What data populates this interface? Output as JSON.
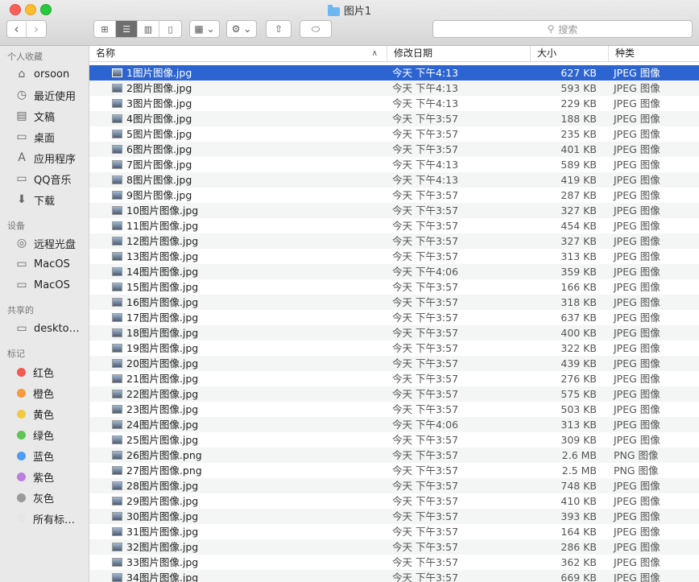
{
  "window": {
    "title": "图片1"
  },
  "toolbar": {
    "back_icon": "‹",
    "forward_icon": "›",
    "view_icons": [
      "⊞",
      "☰",
      "▥",
      "▯"
    ],
    "group_icon": "▦ ⌄",
    "action_icon": "⚙ ⌄",
    "share_icon": "⇧",
    "tag_icon": "⬭",
    "search_placeholder": "搜索"
  },
  "sidebar": {
    "favorites_title": "个人收藏",
    "favorites": [
      {
        "label": "orsoon",
        "icon": "⌂"
      },
      {
        "label": "最近使用",
        "icon": "◷"
      },
      {
        "label": "文稿",
        "icon": "▤"
      },
      {
        "label": "桌面",
        "icon": "▭"
      },
      {
        "label": "应用程序",
        "icon": "A"
      },
      {
        "label": "QQ音乐",
        "icon": "▭"
      },
      {
        "label": "下载",
        "icon": "⬇"
      }
    ],
    "devices_title": "设备",
    "devices": [
      {
        "label": "远程光盘",
        "icon": "◎"
      },
      {
        "label": "MacOS",
        "icon": "▭"
      },
      {
        "label": "MacOS",
        "icon": "▭"
      }
    ],
    "shared_title": "共享的",
    "shared": [
      {
        "label": "deskto…",
        "icon": "▭"
      }
    ],
    "tags_title": "标记",
    "tags": [
      {
        "label": "红色",
        "color": "#f05a4f"
      },
      {
        "label": "橙色",
        "color": "#f59a3b"
      },
      {
        "label": "黄色",
        "color": "#f3c941"
      },
      {
        "label": "绿色",
        "color": "#5cc755"
      },
      {
        "label": "蓝色",
        "color": "#4f9cf3"
      },
      {
        "label": "紫色",
        "color": "#bb7fdc"
      },
      {
        "label": "灰色",
        "color": "#9a9a9a"
      },
      {
        "label": "所有标…",
        "color": "#e6e6e6"
      }
    ]
  },
  "columns": {
    "name": "名称",
    "sort_icon": "∧",
    "date": "修改日期",
    "size": "大小",
    "kind": "种类"
  },
  "files": [
    {
      "name": "1图片图像.jpg",
      "date": "今天 下午4:13",
      "size": "627 KB",
      "kind": "JPEG 图像"
    },
    {
      "name": "2图片图像.jpg",
      "date": "今天 下午4:13",
      "size": "593 KB",
      "kind": "JPEG 图像"
    },
    {
      "name": "3图片图像.jpg",
      "date": "今天 下午4:13",
      "size": "229 KB",
      "kind": "JPEG 图像"
    },
    {
      "name": "4图片图像.jpg",
      "date": "今天 下午3:57",
      "size": "188 KB",
      "kind": "JPEG 图像"
    },
    {
      "name": "5图片图像.jpg",
      "date": "今天 下午3:57",
      "size": "235 KB",
      "kind": "JPEG 图像"
    },
    {
      "name": "6图片图像.jpg",
      "date": "今天 下午3:57",
      "size": "401 KB",
      "kind": "JPEG 图像"
    },
    {
      "name": "7图片图像.jpg",
      "date": "今天 下午4:13",
      "size": "589 KB",
      "kind": "JPEG 图像"
    },
    {
      "name": "8图片图像.jpg",
      "date": "今天 下午4:13",
      "size": "419 KB",
      "kind": "JPEG 图像"
    },
    {
      "name": "9图片图像.jpg",
      "date": "今天 下午3:57",
      "size": "287 KB",
      "kind": "JPEG 图像"
    },
    {
      "name": "10图片图像.jpg",
      "date": "今天 下午3:57",
      "size": "327 KB",
      "kind": "JPEG 图像"
    },
    {
      "name": "11图片图像.jpg",
      "date": "今天 下午3:57",
      "size": "454 KB",
      "kind": "JPEG 图像"
    },
    {
      "name": "12图片图像.jpg",
      "date": "今天 下午3:57",
      "size": "327 KB",
      "kind": "JPEG 图像"
    },
    {
      "name": "13图片图像.jpg",
      "date": "今天 下午3:57",
      "size": "313 KB",
      "kind": "JPEG 图像"
    },
    {
      "name": "14图片图像.jpg",
      "date": "今天 下午4:06",
      "size": "359 KB",
      "kind": "JPEG 图像"
    },
    {
      "name": "15图片图像.jpg",
      "date": "今天 下午3:57",
      "size": "166 KB",
      "kind": "JPEG 图像"
    },
    {
      "name": "16图片图像.jpg",
      "date": "今天 下午3:57",
      "size": "318 KB",
      "kind": "JPEG 图像"
    },
    {
      "name": "17图片图像.jpg",
      "date": "今天 下午3:57",
      "size": "637 KB",
      "kind": "JPEG 图像"
    },
    {
      "name": "18图片图像.jpg",
      "date": "今天 下午3:57",
      "size": "400 KB",
      "kind": "JPEG 图像"
    },
    {
      "name": "19图片图像.jpg",
      "date": "今天 下午3:57",
      "size": "322 KB",
      "kind": "JPEG 图像"
    },
    {
      "name": "20图片图像.jpg",
      "date": "今天 下午3:57",
      "size": "439 KB",
      "kind": "JPEG 图像"
    },
    {
      "name": "21图片图像.jpg",
      "date": "今天 下午3:57",
      "size": "276 KB",
      "kind": "JPEG 图像"
    },
    {
      "name": "22图片图像.jpg",
      "date": "今天 下午3:57",
      "size": "575 KB",
      "kind": "JPEG 图像"
    },
    {
      "name": "23图片图像.jpg",
      "date": "今天 下午3:57",
      "size": "503 KB",
      "kind": "JPEG 图像"
    },
    {
      "name": "24图片图像.jpg",
      "date": "今天 下午4:06",
      "size": "313 KB",
      "kind": "JPEG 图像"
    },
    {
      "name": "25图片图像.jpg",
      "date": "今天 下午3:57",
      "size": "309 KB",
      "kind": "JPEG 图像"
    },
    {
      "name": "26图片图像.png",
      "date": "今天 下午3:57",
      "size": "2.6 MB",
      "kind": "PNG 图像"
    },
    {
      "name": "27图片图像.png",
      "date": "今天 下午3:57",
      "size": "2.5 MB",
      "kind": "PNG 图像"
    },
    {
      "name": "28图片图像.jpg",
      "date": "今天 下午3:57",
      "size": "748 KB",
      "kind": "JPEG 图像"
    },
    {
      "name": "29图片图像.jpg",
      "date": "今天 下午3:57",
      "size": "410 KB",
      "kind": "JPEG 图像"
    },
    {
      "name": "30图片图像.jpg",
      "date": "今天 下午3:57",
      "size": "393 KB",
      "kind": "JPEG 图像"
    },
    {
      "name": "31图片图像.jpg",
      "date": "今天 下午3:57",
      "size": "164 KB",
      "kind": "JPEG 图像"
    },
    {
      "name": "32图片图像.jpg",
      "date": "今天 下午3:57",
      "size": "286 KB",
      "kind": "JPEG 图像"
    },
    {
      "name": "33图片图像.jpg",
      "date": "今天 下午3:57",
      "size": "362 KB",
      "kind": "JPEG 图像"
    },
    {
      "name": "34图片图像.jpg",
      "date": "今天 下午3:57",
      "size": "669 KB",
      "kind": "JPEG 图像"
    }
  ],
  "selected_index": 0
}
